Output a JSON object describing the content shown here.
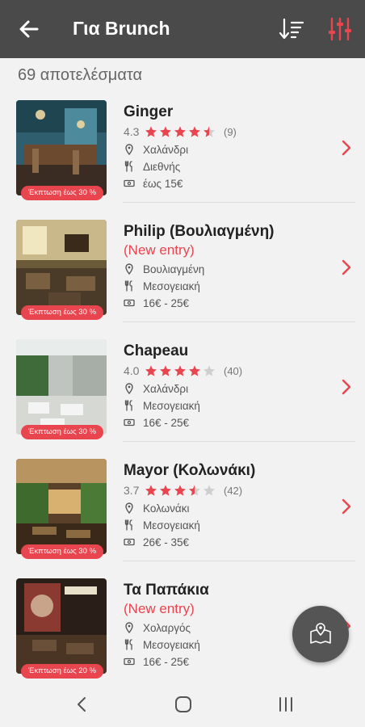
{
  "header": {
    "title": "Για Brunch",
    "back_icon": "arrow-left-icon",
    "sort_icon": "sort-icon",
    "filter_icon": "sliders-icon",
    "accent": "#e8454f",
    "bar_color": "#4a4a4a"
  },
  "results_count": "69 αποτελέσματα",
  "restaurants": [
    {
      "name": "Ginger",
      "rating": "4.3",
      "rating_value": 4.3,
      "reviews": "(9)",
      "new_entry": "",
      "area": "Χαλάνδρι",
      "cuisine": "Διεθνής",
      "price": "έως 15€",
      "discount": "Έκπτωση έως 30 %"
    },
    {
      "name": "Philip (Βουλιαγμένη)",
      "rating": "",
      "rating_value": null,
      "reviews": "",
      "new_entry": "(New entry)",
      "area": "Βουλιαγμένη",
      "cuisine": "Μεσογειακή",
      "price": "16€ - 25€",
      "discount": "Έκπτωση έως 30 %"
    },
    {
      "name": "Chapeau",
      "rating": "4.0",
      "rating_value": 4.0,
      "reviews": "(40)",
      "new_entry": "",
      "area": "Χαλάνδρι",
      "cuisine": "Μεσογειακή",
      "price": "16€ - 25€",
      "discount": "Έκπτωση έως 30 %"
    },
    {
      "name": "Mayor (Κολωνάκι)",
      "rating": "3.7",
      "rating_value": 3.7,
      "reviews": "(42)",
      "new_entry": "",
      "area": "Κολωνάκι",
      "cuisine": "Μεσογειακή",
      "price": "26€ - 35€",
      "discount": "Έκπτωση έως 30 %"
    },
    {
      "name": "Τα Παπάκια",
      "rating": "",
      "rating_value": null,
      "reviews": "",
      "new_entry": "(New entry)",
      "area": "Χολαργός",
      "cuisine": "Μεσογειακή",
      "price": "16€ - 25€",
      "discount": "Έκπτωση έως 20 %"
    }
  ],
  "fab_icon": "map-pin-icon",
  "nav": {
    "back_icon": "nav-back-icon",
    "home_icon": "nav-home-icon",
    "recents_icon": "nav-recents-icon"
  }
}
